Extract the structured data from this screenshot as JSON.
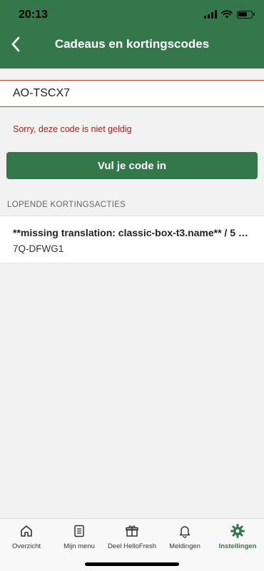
{
  "status_bar": {
    "time": "20:13"
  },
  "header": {
    "title": "Cadeaus en kortingscodes",
    "back_icon": "chevron-left-icon"
  },
  "code_input": {
    "value": "AO-TSCX7",
    "placeholder": ""
  },
  "error": {
    "message": "Sorry, deze code is niet geldig",
    "color": "#a4231c"
  },
  "submit_button": {
    "label": "Vul je code in"
  },
  "running_promotions": {
    "header": "LOPENDE KORTINGSACTIES",
    "items": [
      {
        "title": "**missing translation: classic-box-t3.name** / 5 ma…",
        "code": "7Q-DFWG1"
      }
    ]
  },
  "tab_bar": {
    "items": [
      {
        "label": "Overzicht",
        "icon": "home-icon",
        "active": false
      },
      {
        "label": "Mijn menu",
        "icon": "menu-list-icon",
        "active": false
      },
      {
        "label": "Deel HelloFresh",
        "icon": "gift-icon",
        "active": false
      },
      {
        "label": "Meldingen",
        "icon": "bell-icon",
        "active": false
      },
      {
        "label": "Instellingen",
        "icon": "gear-icon",
        "active": true
      }
    ]
  },
  "colors": {
    "brand_green": "#34774a",
    "error_red": "#a4231c",
    "background": "#f2f2f2"
  }
}
